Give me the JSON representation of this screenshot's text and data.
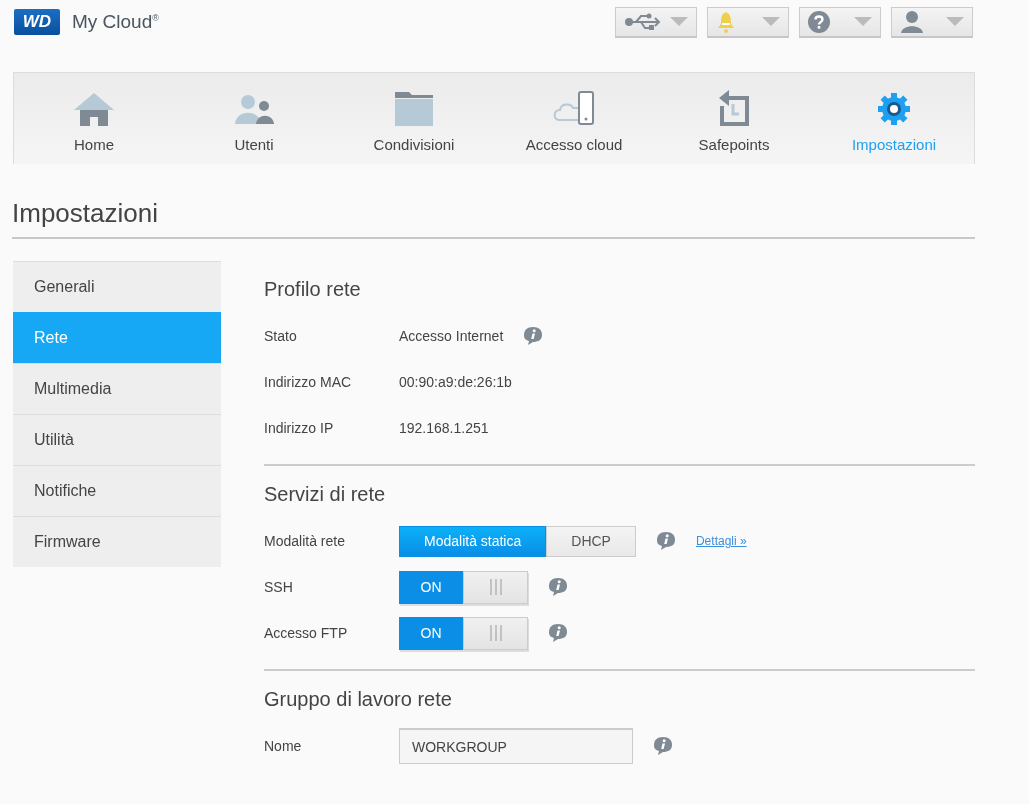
{
  "header": {
    "logo": "WD",
    "product": "My Cloud$^{®}$",
    "tools": [
      {
        "kind": "usb"
      },
      {
        "kind": "bell"
      },
      {
        "kind": "help"
      },
      {
        "kind": "user"
      }
    ]
  },
  "nav": [
    {
      "label": "Home",
      "kind": "home",
      "selected": false
    },
    {
      "label": "Utenti",
      "kind": "users",
      "selected": false
    },
    {
      "label": "Condivisioni",
      "kind": "folder",
      "selected": false
    },
    {
      "label": "Accesso cloud",
      "kind": "cloud",
      "selected": false
    },
    {
      "label": "Safepoints",
      "kind": "safepoint",
      "selected": false
    },
    {
      "label": "Impostazioni",
      "kind": "gear",
      "selected": true
    }
  ],
  "page_title": "Impostazioni",
  "sidebar": {
    "items": [
      {
        "label": "Generali",
        "selected": false
      },
      {
        "label": "Rete",
        "selected": true
      },
      {
        "label": "Multimedia",
        "selected": false
      },
      {
        "label": "Utilità",
        "selected": false
      },
      {
        "label": "Notifiche",
        "selected": false
      },
      {
        "label": "Firmware",
        "selected": false
      }
    ]
  },
  "sections": [
    {
      "title": "Profilo rete",
      "rows": [
        {
          "kind": "text",
          "label": "Stato",
          "value": "Accesso Internet",
          "info": true
        },
        {
          "kind": "text",
          "label": "Indirizzo MAC",
          "value": "00:90:a9:de:26:1b",
          "info": false
        },
        {
          "kind": "text",
          "label": "Indirizzo IP",
          "value": "192.168.1.251",
          "info": false
        }
      ]
    },
    {
      "title": "Servizi di rete",
      "rows": [
        {
          "kind": "segmented",
          "label": "Modalità rete",
          "options": [
            {
              "label": "Modalità statica",
              "selected": true
            },
            {
              "label": "DHCP",
              "selected": false
            }
          ],
          "info": true,
          "link": "Dettagli »"
        },
        {
          "kind": "toggle",
          "label": "SSH",
          "on": true,
          "on_label": "ON",
          "info": true
        },
        {
          "kind": "toggle",
          "label": "Accesso FTP",
          "on": true,
          "on_label": "ON",
          "info": true
        }
      ]
    },
    {
      "title": "Gruppo di lavoro rete",
      "rows": [
        {
          "kind": "input",
          "label": "Nome",
          "value": "WORKGROUP",
          "info": true
        }
      ]
    }
  ]
}
